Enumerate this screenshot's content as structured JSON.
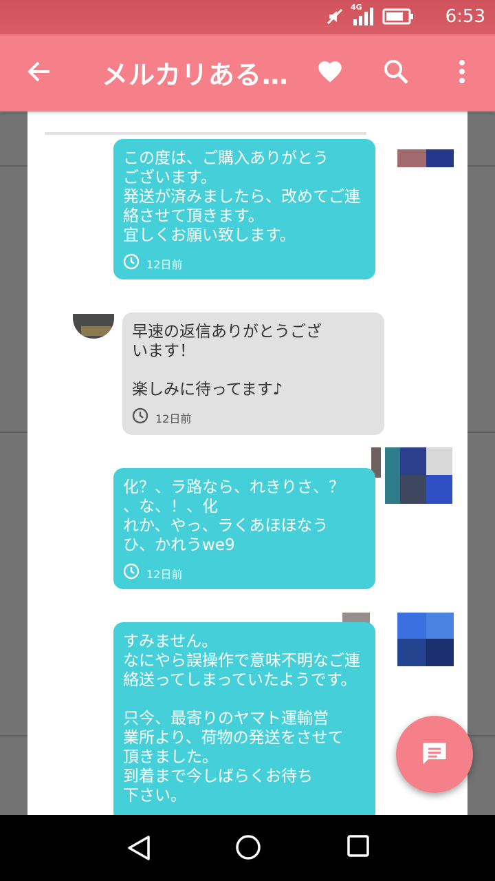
{
  "status_bar": {
    "network": "4G",
    "time": "6:53"
  },
  "app_bar": {
    "title": "メルカリある…"
  },
  "messages": [
    {
      "sender": "me",
      "text": "この度は、ご購入ありがとう\nございます。\n発送が済みましたら、改めてご連\n絡させて頂きます。\n宜しくお願い致します。",
      "time": "12日前"
    },
    {
      "sender": "other",
      "text": "早速の返信ありがとうござ\nいます！\n\n楽しみに待ってます♪",
      "time": "12日前"
    },
    {
      "sender": "me",
      "text": "化？、ラ路なら、れきりさ、？\n、な、！、化\nれか、やっ、ラくあほほなう\nひ、かれうwe9",
      "time": "12日前"
    },
    {
      "sender": "me",
      "text": "すみません。\nなにやら誤操作で意味不明なご連\n絡送ってしまっていたようです。\n\n只今、最寄りのヤマト運輸営\n業所より、荷物の発送をさせて\n頂きました。\n到着まで今しばらくお待ち\n下さい。"
    }
  ],
  "colors": {
    "accent": "#f5808a",
    "status_bar": "#d95d66",
    "my_bubble": "#45d0d9",
    "their_bubble": "#e1e1e1"
  }
}
